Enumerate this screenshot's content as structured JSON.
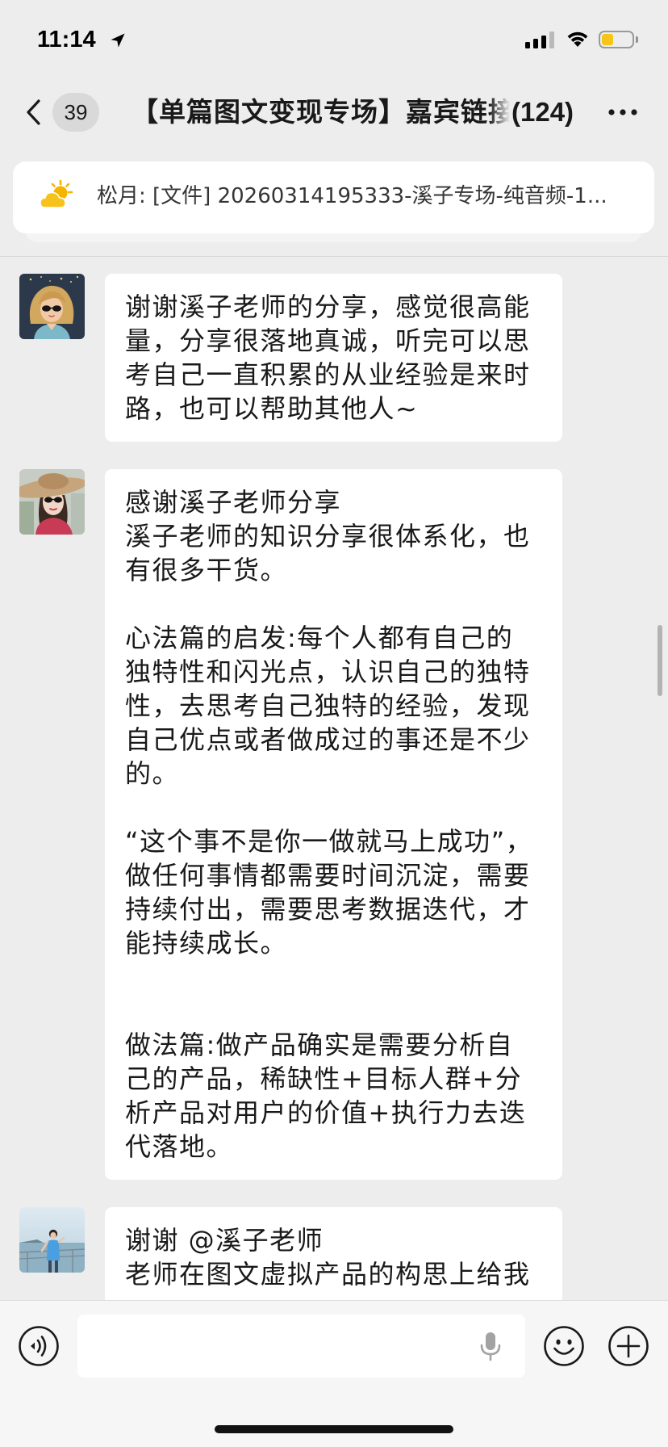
{
  "status_bar": {
    "time": "11:14",
    "location_icon": "location-arrow-icon",
    "signal_icon": "cellular-signal-icon",
    "wifi_icon": "wifi-icon",
    "battery_icon": "battery-icon",
    "battery_level": 0.4
  },
  "nav": {
    "back_icon": "chevron-left-icon",
    "unread_count": "39",
    "title": "【单篇图文变现专场】嘉宾链接",
    "member_count": "(124)",
    "more_icon": "more-dots-icon"
  },
  "pinned": {
    "icon": "sun-cloud-icon",
    "text": "松月: [文件] 20260314195333-溪子专场-纯音频-1..."
  },
  "messages": [
    {
      "avatar": "avatar-cartoon-girl-sunglasses",
      "lines": [
        "谢谢溪子老师的分享，感觉很高能",
        "量，分享很落地真诚，听完可以思",
        "考自己一直积累的从业经验是来时",
        "路，也可以帮助其他人~"
      ]
    },
    {
      "avatar": "avatar-woman-sun-hat",
      "lines": [
        "感谢溪子老师分享",
        "溪子老师的知识分享很体系化，也",
        "有很多干货。",
        "",
        "心法篇的启发:每个人都有自己的",
        "独特性和闪光点，认识自己的独特",
        "性，去思考自己独特的经验，发现",
        "自己优点或者做成过的事还是不少",
        "的。",
        "",
        "“这个事不是你一做就马上成功”，",
        "做任何事情都需要时间沉淀，需要",
        "持续付出，需要思考数据迭代，才",
        "能持续成长。",
        "",
        "",
        "做法篇:做产品确实是需要分析自",
        "己的产品，稀缺性+目标人群+分",
        "析产品对用户的价值+执行力去迭",
        "代落地。"
      ]
    },
    {
      "avatar": "avatar-person-by-water",
      "lines": [
        "谢谢 @溪子老师",
        "老师在图文虚拟产品的构思上给我"
      ]
    }
  ],
  "input_bar": {
    "voice_icon": "voice-icon",
    "mic_icon": "microphone-icon",
    "emoji_icon": "emoji-icon",
    "plus_icon": "plus-icon"
  },
  "colors": {
    "background": "#ededed",
    "bubble": "#ffffff",
    "battery_fill": "#f5c518",
    "badge": "#d9d9d9",
    "text": "#191919"
  }
}
